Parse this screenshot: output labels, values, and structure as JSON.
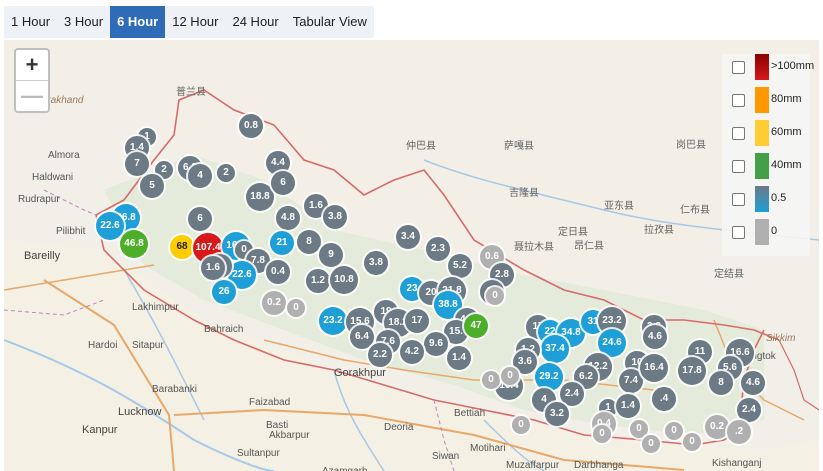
{
  "tabs": [
    {
      "label": "1 Hour",
      "active": false
    },
    {
      "label": "3 Hour",
      "active": false
    },
    {
      "label": "6 Hour",
      "active": true
    },
    {
      "label": "12 Hour",
      "active": false
    },
    {
      "label": "24 Hour",
      "active": false
    },
    {
      "label": "Tabular View",
      "active": false
    }
  ],
  "zoom": {
    "in_label": "+",
    "out_label": "—"
  },
  "legend": [
    {
      "label": ">100mm",
      "color": "#d7191c",
      "color2": "#8b0000"
    },
    {
      "label": "80mm",
      "color": "#ff9800",
      "color2": "#ff9800"
    },
    {
      "label": "60mm",
      "color": "#ffcc33",
      "color2": "#ffcc33"
    },
    {
      "label": "40mm",
      "color": "#43a047",
      "color2": "#43a047"
    },
    {
      "label": "0.5",
      "color": "#1e9fd8",
      "color2": "#6b7a85"
    },
    {
      "label": "0",
      "color": "#b0b0b0",
      "color2": "#b0b0b0"
    }
  ],
  "places": [
    {
      "text": "Uttarakhand",
      "style": "acc"
    },
    {
      "text": "Almora",
      "style": ""
    },
    {
      "text": "Haldwani",
      "style": ""
    },
    {
      "text": "Rudrapur",
      "style": ""
    },
    {
      "text": "Pilibhit",
      "style": ""
    },
    {
      "text": "Bareilly",
      "style": "big"
    },
    {
      "text": "Lakhimpur",
      "style": ""
    },
    {
      "text": "Bahraich",
      "style": ""
    },
    {
      "text": "Hardoi",
      "style": ""
    },
    {
      "text": "Sitapur",
      "style": ""
    },
    {
      "text": "Barabanki",
      "style": ""
    },
    {
      "text": "Lucknow",
      "style": "big"
    },
    {
      "text": "Kanpur",
      "style": "big"
    },
    {
      "text": "Faizabad",
      "style": ""
    },
    {
      "text": "Basti",
      "style": ""
    },
    {
      "text": "Gorakhpur",
      "style": "big"
    },
    {
      "text": "Akbarpur",
      "style": ""
    },
    {
      "text": "Sultanpur",
      "style": ""
    },
    {
      "text": "Azamgarh",
      "style": ""
    },
    {
      "text": "Deoria",
      "style": ""
    },
    {
      "text": "Bettiah",
      "style": ""
    },
    {
      "text": "Motihari",
      "style": ""
    },
    {
      "text": "Siwan",
      "style": ""
    },
    {
      "text": "Muzaffarpur",
      "style": ""
    },
    {
      "text": "Darbhanga",
      "style": ""
    },
    {
      "text": "Kishanganj",
      "style": ""
    },
    {
      "text": "Gangtok",
      "style": ""
    },
    {
      "text": "Sikkim",
      "style": "acc"
    },
    {
      "text": "普兰县",
      "style": "cn"
    },
    {
      "text": "仲巴县",
      "style": "cn"
    },
    {
      "text": "萨嘎县",
      "style": "cn"
    },
    {
      "text": "吉隆县",
      "style": "cn"
    },
    {
      "text": "聂拉木县",
      "style": "cn"
    },
    {
      "text": "定日县",
      "style": "cn"
    },
    {
      "text": "亚东县",
      "style": "cn"
    },
    {
      "text": "岗巴县",
      "style": "cn"
    },
    {
      "text": "定结县",
      "style": "cn"
    },
    {
      "text": "仁布县",
      "style": "cn"
    },
    {
      "text": "拉孜县",
      "style": "cn"
    },
    {
      "text": "昂仁县",
      "style": "cn"
    }
  ],
  "markers": [
    {
      "v": "1",
      "c": "#6b7a85"
    },
    {
      "v": "1.4",
      "c": "#6b7a85"
    },
    {
      "v": "7",
      "c": "#6b7a85"
    },
    {
      "v": "2",
      "c": "#6b7a85"
    },
    {
      "v": "5",
      "c": "#6b7a85"
    },
    {
      "v": "6.2",
      "c": "#6b7a85"
    },
    {
      "v": "4",
      "c": "#6b7a85"
    },
    {
      "v": "2",
      "c": "#6b7a85"
    },
    {
      "v": "0.8",
      "c": "#6b7a85"
    },
    {
      "v": "18.8",
      "c": "#6b7a85"
    },
    {
      "v": "4.4",
      "c": "#6b7a85"
    },
    {
      "v": "6",
      "c": "#6b7a85"
    },
    {
      "v": "26.8",
      "c": "#1e9fd8"
    },
    {
      "v": "22.6",
      "c": "#1e9fd8"
    },
    {
      "v": "46.8",
      "c": "#4caf2a"
    },
    {
      "v": "68",
      "c": "#ffcc00"
    },
    {
      "v": "107.4",
      "c": "#d7191c"
    },
    {
      "v": "16.4",
      "c": "#1e9fd8"
    },
    {
      "v": "6",
      "c": "#6b7a85"
    },
    {
      "v": "1.6",
      "c": "#6b7a85"
    },
    {
      "v": "3.8",
      "c": "#6b7a85"
    },
    {
      "v": "4.8",
      "c": "#6b7a85"
    },
    {
      "v": "21",
      "c": "#1e9fd8"
    },
    {
      "v": "8",
      "c": "#6b7a85"
    },
    {
      "v": "0",
      "c": "#6b7a85"
    },
    {
      "v": "9",
      "c": "#6b7a85"
    },
    {
      "v": "7.8",
      "c": "#6b7a85"
    },
    {
      "v": "22.6",
      "c": "#1e9fd8"
    },
    {
      "v": "26",
      "c": "#1e9fd8"
    },
    {
      "v": "11",
      "c": "#6b7a85"
    },
    {
      "v": "1.6",
      "c": "#6b7a85"
    },
    {
      "v": "0.4",
      "c": "#6b7a85"
    },
    {
      "v": "1.2",
      "c": "#6b7a85"
    },
    {
      "v": "10.8",
      "c": "#6b7a85"
    },
    {
      "v": "3.4",
      "c": "#6b7a85"
    },
    {
      "v": "2.3",
      "c": "#6b7a85"
    },
    {
      "v": "3.8",
      "c": "#6b7a85"
    },
    {
      "v": "5.2",
      "c": "#6b7a85"
    },
    {
      "v": "0.6",
      "c": "#b0b0b0"
    },
    {
      "v": "2.8",
      "c": "#6b7a85"
    },
    {
      "v": "23",
      "c": "#1e9fd8"
    },
    {
      "v": "20",
      "c": "#6b7a85"
    },
    {
      "v": "21.8",
      "c": "#6b7a85"
    },
    {
      "v": "4.8",
      "c": "#6b7a85"
    },
    {
      "v": "38.8",
      "c": "#1e9fd8"
    },
    {
      "v": "4.8",
      "c": "#6b7a85"
    },
    {
      "v": "0",
      "c": "#b0b0b0"
    },
    {
      "v": "0.2",
      "c": "#b0b0b0"
    },
    {
      "v": "0",
      "c": "#b0b0b0"
    },
    {
      "v": "23.2",
      "c": "#1e9fd8"
    },
    {
      "v": "15.6",
      "c": "#6b7a85"
    },
    {
      "v": "19",
      "c": "#6b7a85"
    },
    {
      "v": "18.2",
      "c": "#6b7a85"
    },
    {
      "v": "17",
      "c": "#6b7a85"
    },
    {
      "v": "15.",
      "c": "#6b7a85"
    },
    {
      "v": "47",
      "c": "#4caf2a"
    },
    {
      "v": "6.4",
      "c": "#6b7a85"
    },
    {
      "v": "7.6",
      "c": "#6b7a85"
    },
    {
      "v": "9.6",
      "c": "#6b7a85"
    },
    {
      "v": "2.2",
      "c": "#6b7a85"
    },
    {
      "v": "4.2",
      "c": "#6b7a85"
    },
    {
      "v": "1.4",
      "c": "#6b7a85"
    },
    {
      "v": "4",
      "c": "#6b7a85"
    },
    {
      "v": "17",
      "c": "#6b7a85"
    },
    {
      "v": "22",
      "c": "#1e9fd8"
    },
    {
      "v": "34.8",
      "c": "#1e9fd8"
    },
    {
      "v": "31",
      "c": "#1e9fd8"
    },
    {
      "v": "23.2",
      "c": "#6b7a85"
    },
    {
      "v": "37.4",
      "c": "#1e9fd8"
    },
    {
      "v": "24.6",
      "c": "#1e9fd8"
    },
    {
      "v": "3.2",
      "c": "#6b7a85"
    },
    {
      "v": "4.6",
      "c": "#6b7a85"
    },
    {
      "v": "1.2",
      "c": "#6b7a85"
    },
    {
      "v": "3.6",
      "c": "#6b7a85"
    },
    {
      "v": "12.2",
      "c": "#6b7a85"
    },
    {
      "v": "6.2",
      "c": "#6b7a85"
    },
    {
      "v": "10",
      "c": "#6b7a85"
    },
    {
      "v": "7.4",
      "c": "#6b7a85"
    },
    {
      "v": "16.4",
      "c": "#6b7a85"
    },
    {
      "v": "11",
      "c": "#6b7a85"
    },
    {
      "v": "16.6",
      "c": "#6b7a85"
    },
    {
      "v": "17.8",
      "c": "#6b7a85"
    },
    {
      "v": "5.6",
      "c": "#6b7a85"
    },
    {
      "v": "8",
      "c": "#6b7a85"
    },
    {
      "v": "4.6",
      "c": "#6b7a85"
    },
    {
      "v": "10.4",
      "c": "#6b7a85"
    },
    {
      "v": "29.2",
      "c": "#1e9fd8"
    },
    {
      "v": "4",
      "c": "#6b7a85"
    },
    {
      "v": "2.4",
      "c": "#6b7a85"
    },
    {
      "v": "3.2",
      "c": "#6b7a85"
    },
    {
      "v": "1",
      "c": "#6b7a85"
    },
    {
      "v": "1.4",
      "c": "#6b7a85"
    },
    {
      "v": ".4",
      "c": "#6b7a85"
    },
    {
      "v": "2.4",
      "c": "#6b7a85"
    },
    {
      "v": "0.4",
      "c": "#b0b0b0"
    },
    {
      "v": "0.2",
      "c": "#b0b0b0"
    },
    {
      "v": ".2",
      "c": "#b0b0b0"
    },
    {
      "v": "0",
      "c": "#b0b0b0"
    },
    {
      "v": "0",
      "c": "#b0b0b0"
    },
    {
      "v": "0",
      "c": "#b0b0b0"
    },
    {
      "v": "0",
      "c": "#b0b0b0"
    },
    {
      "v": "0",
      "c": "#b0b0b0"
    },
    {
      "v": "0",
      "c": "#b0b0b0"
    },
    {
      "v": "0",
      "c": "#b0b0b0"
    },
    {
      "v": "0",
      "c": "#b0b0b0"
    }
  ]
}
